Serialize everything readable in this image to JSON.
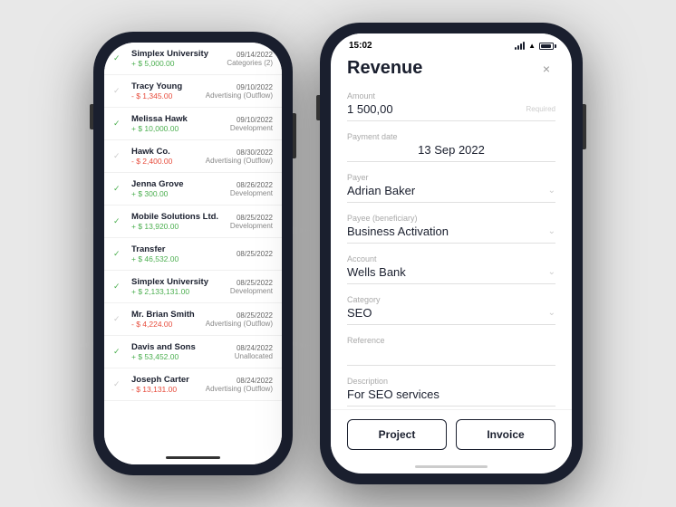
{
  "left_phone": {
    "transactions": [
      {
        "name": "Simplex University",
        "amount": "+ $ 5,000.00",
        "type": "positive",
        "date": "09/14/2022",
        "category": "Categories (2)",
        "checked": true
      },
      {
        "name": "Tracy Young",
        "amount": "- $ 1,345.00",
        "type": "negative",
        "date": "09/10/2022",
        "category": "Advertising (Outflow)",
        "checked": true
      },
      {
        "name": "Melissa Hawk",
        "amount": "+ $ 10,000.00",
        "type": "positive",
        "date": "09/10/2022",
        "category": "Development",
        "checked": true
      },
      {
        "name": "Hawk Co.",
        "amount": "- $ 2,400.00",
        "type": "negative",
        "date": "08/30/2022",
        "category": "Advertising (Outflow)",
        "checked": true
      },
      {
        "name": "Jenna Grove",
        "amount": "+ $ 300.00",
        "type": "positive",
        "date": "08/26/2022",
        "category": "Development",
        "checked": true
      },
      {
        "name": "Mobile Solutions Ltd.",
        "amount": "+ $ 13,920.00",
        "type": "positive",
        "date": "08/25/2022",
        "category": "Development",
        "checked": true
      },
      {
        "name": "Transfer",
        "amount": "+ $ 46,532.00",
        "type": "positive",
        "date": "08/25/2022",
        "category": "",
        "checked": true
      },
      {
        "name": "Simplex University",
        "amount": "+ $ 2,133,131.00",
        "type": "positive",
        "date": "08/25/2022",
        "category": "Development",
        "checked": true
      },
      {
        "name": "Mr. Brian Smith",
        "amount": "- $ 4,224.00",
        "type": "negative",
        "date": "08/25/2022",
        "category": "Advertising (Outflow)",
        "checked": true
      },
      {
        "name": "Davis and Sons",
        "amount": "+ $ 53,452.00",
        "type": "positive",
        "date": "08/24/2022",
        "category": "Unallocated",
        "checked": true
      },
      {
        "name": "Joseph Carter",
        "amount": "- $ 13,131.00",
        "type": "negative",
        "date": "08/24/2022",
        "category": "Advertising (Outflow)",
        "checked": true
      }
    ]
  },
  "right_phone": {
    "status_bar": {
      "time": "15:02"
    },
    "modal": {
      "title": "Revenue",
      "close_label": "×",
      "fields": [
        {
          "id": "amount",
          "label": "Amount",
          "value": "1 500,00",
          "required": "Required",
          "type": "value"
        },
        {
          "id": "payment_date",
          "label": "Payment date",
          "value": "13 Sep 2022",
          "type": "center"
        },
        {
          "id": "payer",
          "label": "Payer",
          "value": "Adrian Baker",
          "type": "dropdown"
        },
        {
          "id": "payee",
          "label": "Payee (beneficiary)",
          "value": "Business Activation",
          "type": "dropdown"
        },
        {
          "id": "account",
          "label": "Account",
          "value": "Wells Bank",
          "type": "dropdown"
        },
        {
          "id": "category",
          "label": "Category",
          "value": "SEO",
          "type": "dropdown"
        },
        {
          "id": "reference",
          "label": "Reference",
          "value": "",
          "type": "empty"
        },
        {
          "id": "description",
          "label": "Description",
          "value": "For SEO services",
          "type": "value"
        }
      ],
      "footer_buttons": [
        {
          "id": "project",
          "label": "Project"
        },
        {
          "id": "invoice",
          "label": "Invoice"
        }
      ]
    }
  }
}
